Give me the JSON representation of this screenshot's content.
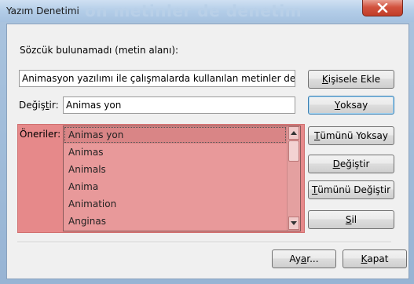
{
  "window": {
    "title": "Yazım Denetimi",
    "background_text": "on metinler de denetim",
    "close_icon": "close-x-icon"
  },
  "dialog": {
    "not_found_label": "Sözcük bulunamadı (metin alanı):",
    "context_text": "Animasyon yazılımı ile çalışmalarda kullanılan metinler de dene",
    "change_to": {
      "label_pre": "Değiş",
      "label_ul": "t",
      "label_post": "ir:",
      "value": "Animas yon"
    },
    "suggestions_label": "Öneriler:",
    "suggestions": [
      "Animas yon",
      "Animas",
      "Animals",
      "Anima",
      "Animation",
      "Anginas"
    ],
    "buttons": {
      "add_to_dictionary": {
        "pre": "",
        "ul": "K",
        "post": "işisele Ekle"
      },
      "ignore": {
        "pre": "",
        "ul": "Y",
        "post": "oksay"
      },
      "ignore_all": {
        "pre": "",
        "ul": "T",
        "post": "ümünü Yoksay"
      },
      "change": {
        "pre": "",
        "ul": "D",
        "post": "eğiştir"
      },
      "change_all": {
        "pre": "",
        "ul": "T",
        "post": "ümünü Değiştir"
      },
      "delete": {
        "pre": "",
        "ul": "S",
        "post": "il"
      },
      "options": {
        "pre": "Ay",
        "ul": "a",
        "post": "r..."
      },
      "close": {
        "pre": "",
        "ul": "K",
        "post": "apat"
      }
    },
    "highlight_color": "#e6898a"
  }
}
